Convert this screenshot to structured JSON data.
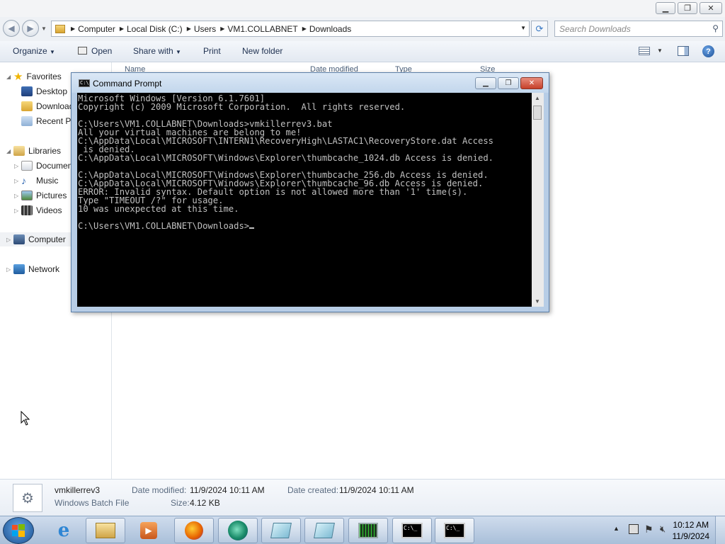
{
  "explorer": {
    "address": [
      "Computer",
      "Local Disk (C:)",
      "Users",
      "VM1.COLLABNET",
      "Downloads"
    ],
    "search_placeholder": "Search Downloads",
    "commands": {
      "organize": "Organize",
      "open": "Open",
      "share_with": "Share with",
      "print": "Print",
      "new_folder": "New folder"
    },
    "columns": [
      "Name",
      "Date modified",
      "Type",
      "Size"
    ],
    "nav": {
      "favorites": "Favorites",
      "desktop": "Desktop",
      "downloads": "Downloads",
      "recent": "Recent Places",
      "libraries": "Libraries",
      "documents": "Documents",
      "music": "Music",
      "pictures": "Pictures",
      "videos": "Videos",
      "computer": "Computer",
      "network": "Network"
    },
    "details": {
      "file_name": "vmkillerrev3",
      "file_type": "Windows Batch File",
      "date_modified_label": "Date modified:",
      "date_modified": "11/9/2024 10:11 AM",
      "size_label": "Size:",
      "size": "4.12 KB",
      "date_created_label": "Date created:",
      "date_created": "11/9/2024 10:11 AM"
    }
  },
  "cmd": {
    "title": "Command Prompt",
    "lines": [
      "Microsoft Windows [Version 6.1.7601]",
      "Copyright (c) 2009 Microsoft Corporation.  All rights reserved.",
      "",
      "C:\\Users\\VM1.COLLABNET\\Downloads>vmkillerrev3.bat",
      "All your virtual machines are belong to me!",
      "C:\\AppData\\Local\\MICROSOFT\\INTERN1\\RecoveryHigh\\LASTAC1\\RecoveryStore.dat Access",
      " is denied.",
      "C:\\AppData\\Local\\MICROSOFT\\Windows\\Explorer\\thumbcache_1024.db Access is denied.",
      "",
      "C:\\AppData\\Local\\MICROSOFT\\Windows\\Explorer\\thumbcache_256.db Access is denied.",
      "C:\\AppData\\Local\\MICROSOFT\\Windows\\Explorer\\thumbcache_96.db Access is denied.",
      "ERROR: Invalid syntax. Default option is not allowed more than '1' time(s).",
      "Type \"TIMEOUT /?\" for usage.",
      "10 was unexpected at this time.",
      "",
      "C:\\Users\\VM1.COLLABNET\\Downloads>"
    ]
  },
  "taskbar": {
    "time": "10:12 AM",
    "date": "11/9/2024"
  }
}
